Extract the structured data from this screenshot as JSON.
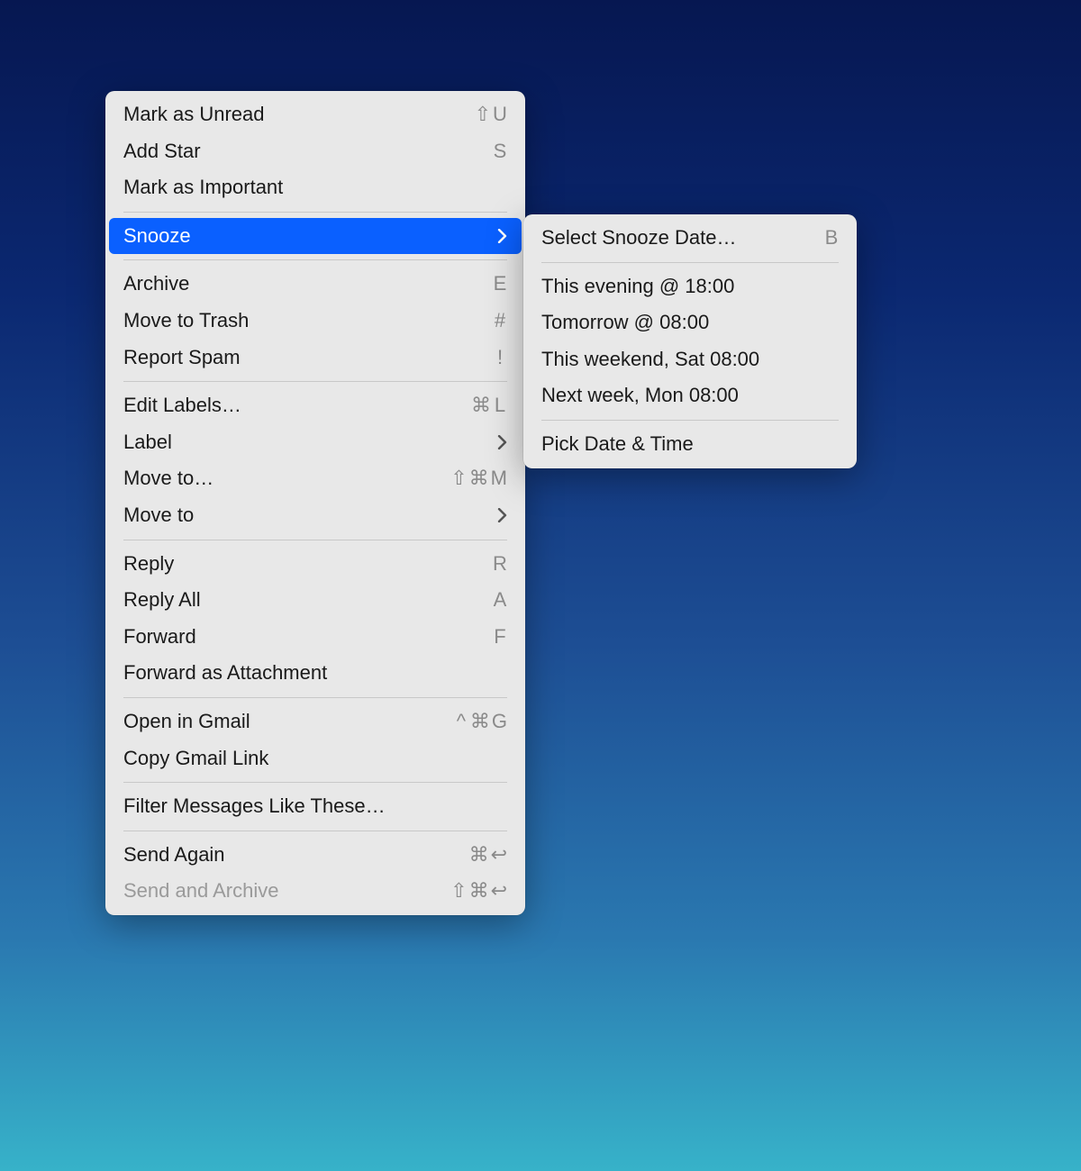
{
  "main_menu": {
    "groups": [
      [
        {
          "id": "mark-unread",
          "label": "Mark as Unread",
          "shortcut": "⇧ U",
          "submenu": false,
          "disabled": false
        },
        {
          "id": "add-star",
          "label": "Add Star",
          "shortcut": "S",
          "submenu": false,
          "disabled": false
        },
        {
          "id": "mark-important",
          "label": "Mark as Important",
          "shortcut": "",
          "submenu": false,
          "disabled": false
        }
      ],
      [
        {
          "id": "snooze",
          "label": "Snooze",
          "shortcut": "",
          "submenu": true,
          "disabled": false,
          "highlighted": true
        }
      ],
      [
        {
          "id": "archive",
          "label": "Archive",
          "shortcut": "E",
          "submenu": false,
          "disabled": false
        },
        {
          "id": "move-trash",
          "label": "Move to Trash",
          "shortcut": "#",
          "submenu": false,
          "disabled": false
        },
        {
          "id": "report-spam",
          "label": "Report Spam",
          "shortcut": "!",
          "submenu": false,
          "disabled": false
        }
      ],
      [
        {
          "id": "edit-labels",
          "label": "Edit Labels…",
          "shortcut": "⌘ L",
          "submenu": false,
          "disabled": false
        },
        {
          "id": "label",
          "label": "Label",
          "shortcut": "",
          "submenu": true,
          "disabled": false
        },
        {
          "id": "move-to-ellipsis",
          "label": "Move to…",
          "shortcut": "⇧ ⌘ M",
          "submenu": false,
          "disabled": false
        },
        {
          "id": "move-to",
          "label": "Move to",
          "shortcut": "",
          "submenu": true,
          "disabled": false
        }
      ],
      [
        {
          "id": "reply",
          "label": "Reply",
          "shortcut": "R",
          "submenu": false,
          "disabled": false
        },
        {
          "id": "reply-all",
          "label": "Reply All",
          "shortcut": "A",
          "submenu": false,
          "disabled": false
        },
        {
          "id": "forward",
          "label": "Forward",
          "shortcut": "F",
          "submenu": false,
          "disabled": false
        },
        {
          "id": "forward-attachment",
          "label": "Forward as Attachment",
          "shortcut": "",
          "submenu": false,
          "disabled": false
        }
      ],
      [
        {
          "id": "open-gmail",
          "label": "Open in Gmail",
          "shortcut": "^ ⌘ G",
          "submenu": false,
          "disabled": false
        },
        {
          "id": "copy-gmail-link",
          "label": "Copy Gmail Link",
          "shortcut": "",
          "submenu": false,
          "disabled": false
        }
      ],
      [
        {
          "id": "filter-messages",
          "label": "Filter Messages Like These…",
          "shortcut": "",
          "submenu": false,
          "disabled": false
        }
      ],
      [
        {
          "id": "send-again",
          "label": "Send Again",
          "shortcut": "⌘ ↩",
          "submenu": false,
          "disabled": false
        },
        {
          "id": "send-archive",
          "label": "Send and Archive",
          "shortcut": "⇧ ⌘ ↩",
          "submenu": false,
          "disabled": true
        }
      ]
    ]
  },
  "sub_menu": {
    "groups": [
      [
        {
          "id": "select-snooze-date",
          "label": "Select Snooze Date…",
          "shortcut": "B",
          "submenu": false,
          "disabled": false
        }
      ],
      [
        {
          "id": "this-evening",
          "label": "This evening @ 18:00",
          "shortcut": "",
          "submenu": false,
          "disabled": false
        },
        {
          "id": "tomorrow",
          "label": "Tomorrow @ 08:00",
          "shortcut": "",
          "submenu": false,
          "disabled": false
        },
        {
          "id": "this-weekend",
          "label": "This weekend, Sat 08:00",
          "shortcut": "",
          "submenu": false,
          "disabled": false
        },
        {
          "id": "next-week",
          "label": "Next week, Mon 08:00",
          "shortcut": "",
          "submenu": false,
          "disabled": false
        }
      ],
      [
        {
          "id": "pick-date-time",
          "label": "Pick Date & Time",
          "shortcut": "",
          "submenu": false,
          "disabled": false
        }
      ]
    ]
  }
}
